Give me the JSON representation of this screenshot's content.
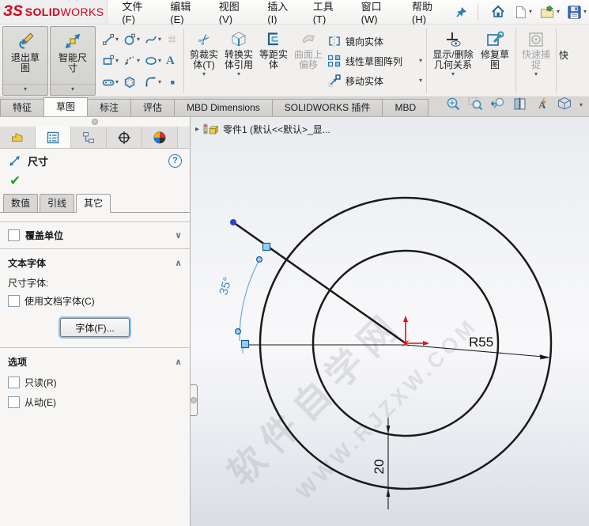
{
  "brand": {
    "mark": "ЗS",
    "solid": "SOLID",
    "works": "WORKS"
  },
  "menu": {
    "items": [
      "文件(F)",
      "编辑(E)",
      "视图(V)",
      "插入(I)",
      "工具(T)",
      "窗口(W)",
      "帮助(H)"
    ]
  },
  "icons": {
    "caret": "▾",
    "arrow_right": "▸",
    "check": "✔",
    "help": "?",
    "chevron_down": "∨",
    "chevron_up": "∧",
    "scissors": "✂",
    "text_tool": "A"
  },
  "ribbon": {
    "exit_sketch": "退出草图",
    "smart_dimension": "智能尺寸",
    "trim_entities": "剪裁实体(T)",
    "convert_entities": "转换实体引用",
    "offset_entities": "等距实体",
    "surface_offset": "曲面上偏移",
    "mirror_entities": "镜向实体",
    "linear_pattern": "线性草图阵列",
    "move_entities": "移动实体",
    "display_delete_relations": "显示/删除几何关系",
    "repair_sketch": "修复草图",
    "quick_snaps": "快速捕捉",
    "clipped_next": "快"
  },
  "tabs": {
    "active": "草图",
    "items": [
      {
        "label": "特征"
      },
      {
        "label": "草图"
      },
      {
        "label": "标注"
      },
      {
        "label": "评估"
      },
      {
        "label": "MBD Dimensions"
      },
      {
        "label": "SOLIDWORKS 插件"
      },
      {
        "label": "MBD"
      }
    ]
  },
  "panel": {
    "title": "尺寸",
    "subtabs": [
      "数值",
      "引线",
      "其它"
    ],
    "active_subtab": "其它",
    "override_units": "覆盖单位",
    "text_font": {
      "section": "文本字体",
      "dim_font_label": "尺寸字体:",
      "use_doc_font": "使用文档字体(C)",
      "font_button": "字体(F)..."
    },
    "options": {
      "section": "选项",
      "read_only": "只读(R)",
      "driven": "从动(E)"
    }
  },
  "graphics": {
    "breadcrumb": "零件1 (默认<<默认>_显...",
    "watermark": {
      "cn": "软件自学网",
      "url": "WWW.RJZXW.COM"
    },
    "dimensions": {
      "angle": "35°",
      "radius": "R55",
      "distance": "20"
    },
    "sketch": {
      "outer_radius_mm": 55,
      "ring_width_mm": 20,
      "line_angle_deg": 35
    }
  }
}
